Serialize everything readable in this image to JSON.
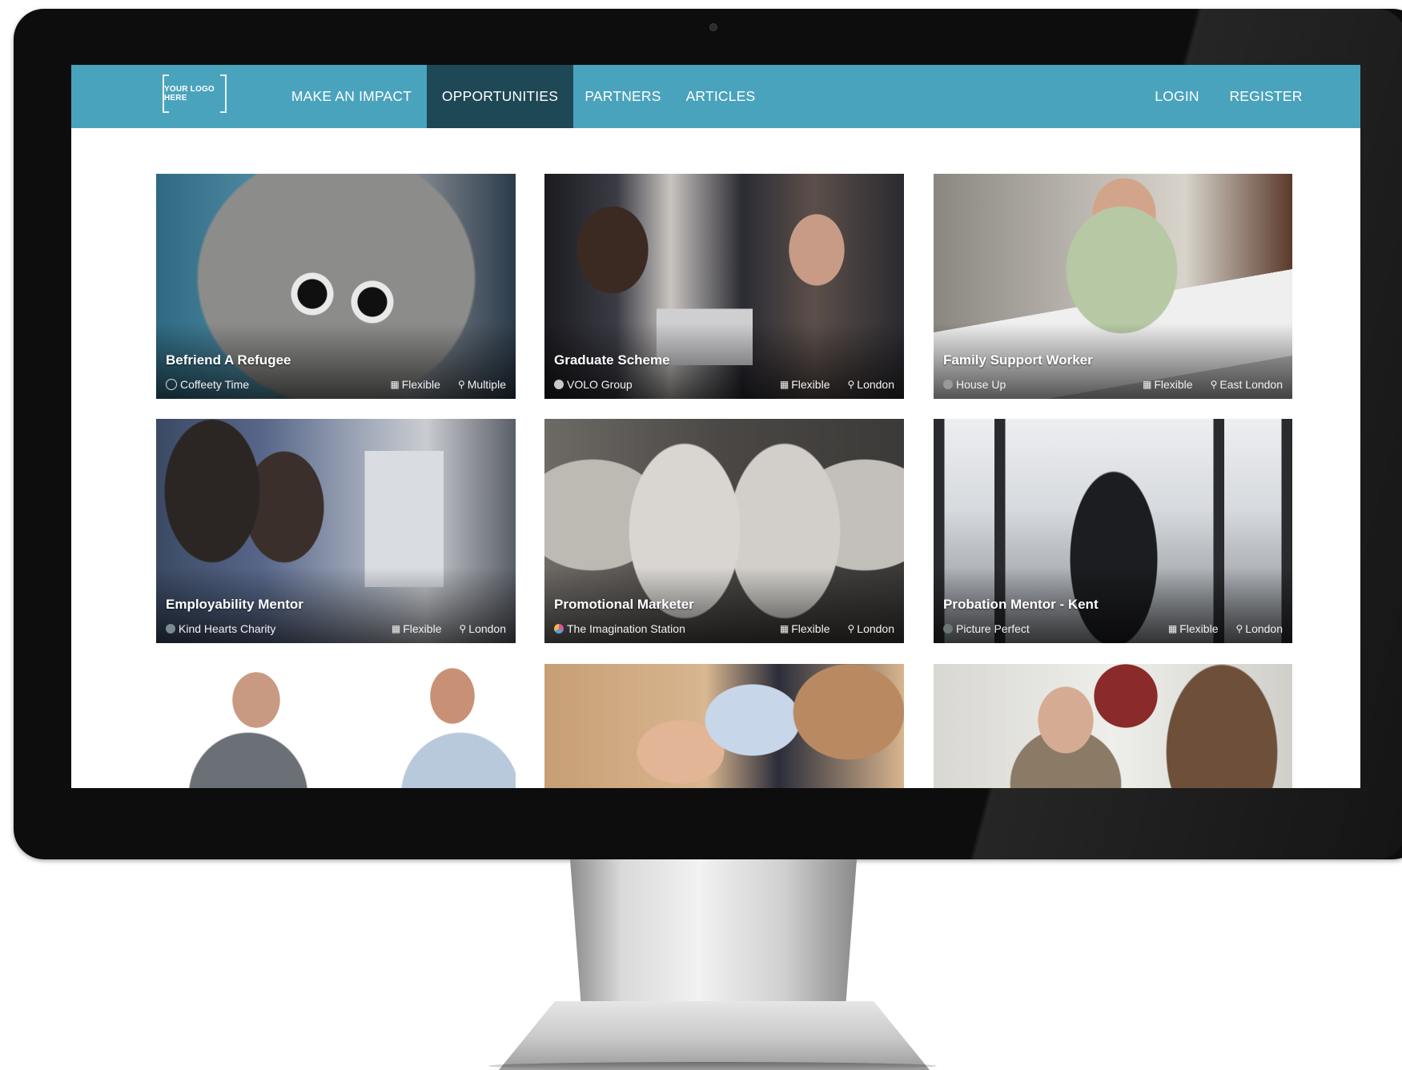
{
  "nav": {
    "logo": "YOUR LOGO HERE",
    "items": [
      {
        "label": "MAKE AN IMPACT",
        "active": false
      },
      {
        "label": "OPPORTUNITIES",
        "active": true
      },
      {
        "label": "PARTNERS",
        "active": false
      },
      {
        "label": "ARTICLES",
        "active": false
      }
    ],
    "login": "LOGIN",
    "register": "REGISTER"
  },
  "colors": {
    "nav_bg": "#4aa3bd",
    "nav_active_bg": "#1f4856",
    "bezel": "#0d0d0d"
  },
  "cards": [
    {
      "title": "Befriend A Refugee",
      "org": "Coffeety Time",
      "org_icon": "org-logo-icon",
      "org_color": "#8a8a8a",
      "availability": "Flexible",
      "location": "Multiple",
      "photo": "two people holding coffee cups over a stone table"
    },
    {
      "title": "Graduate Scheme",
      "org": "VOLO Group",
      "org_icon": "org-logo-icon",
      "org_color": "#c9c9c9",
      "availability": "Flexible",
      "location": "London",
      "photo": "business team around a laptop"
    },
    {
      "title": "Family Support Worker",
      "org": "House Up",
      "org_icon": "org-logo-icon",
      "org_color": "#9a9a9a",
      "availability": "Flexible",
      "location": "East London",
      "photo": "group laughing around a table"
    },
    {
      "title": "Employability Mentor",
      "org": "Kind Hearts Charity",
      "org_icon": "org-logo-icon",
      "org_color": "#7b8a8f",
      "availability": "Flexible",
      "location": "London",
      "photo": "two women at a computer"
    },
    {
      "title": "Promotional Marketer",
      "org": "The Imagination Station",
      "org_icon": "org-logo-icon",
      "org_color": "#c05a9a",
      "availability": "Flexible",
      "location": "London",
      "photo": "baby feet held in hands"
    },
    {
      "title": "Probation Mentor - Kent",
      "org": "Picture Perfect",
      "org_icon": "org-logo-icon",
      "org_color": "#6d7478",
      "availability": "Flexible",
      "location": "London",
      "photo": "person sitting looking at the sea"
    },
    {
      "title": "",
      "org": "",
      "availability": "",
      "location": "",
      "photo": "older man and younger man smiling"
    },
    {
      "title": "",
      "org": "",
      "availability": "",
      "location": "",
      "photo": "child drinking from a bottle"
    },
    {
      "title": "",
      "org": "",
      "availability": "",
      "location": "",
      "photo": "women talking in an office"
    }
  ],
  "icons": {
    "calendar": "calendar-icon",
    "location": "location-pin-icon"
  }
}
